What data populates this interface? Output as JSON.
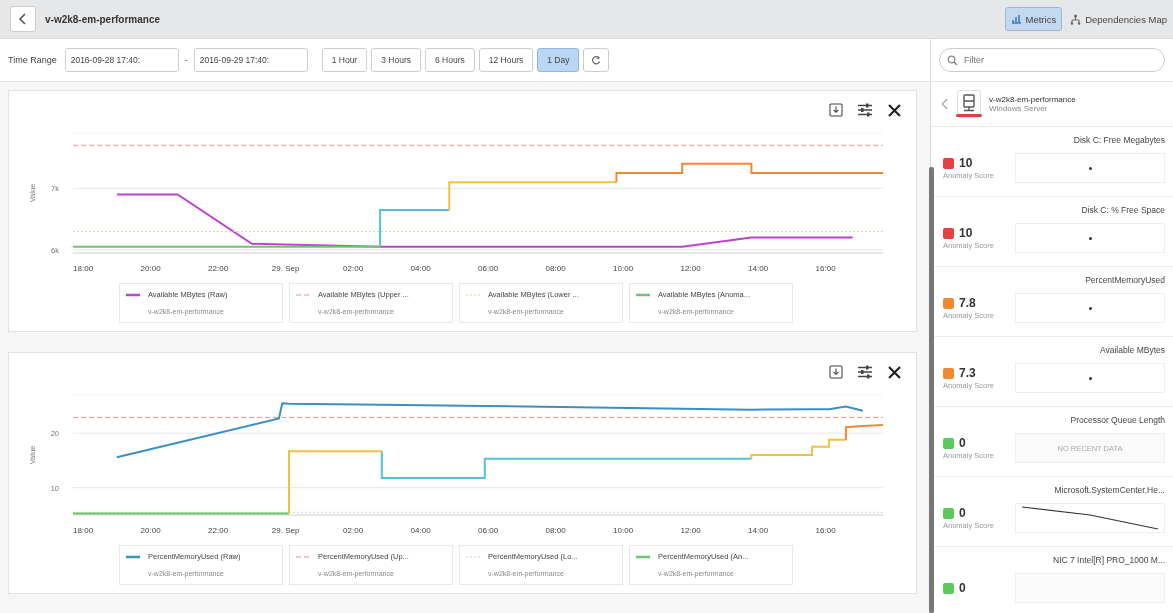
{
  "header": {
    "title": "v-w2k8-em-performance",
    "tabs": [
      {
        "label": "Metrics",
        "selected": true
      },
      {
        "label": "Dependencies Map",
        "selected": false
      }
    ]
  },
  "toolbar": {
    "label": "Time Range",
    "start": "2016-09-28 17:40:",
    "separator": "-",
    "end": "2016-09-29 17:40:",
    "ranges": [
      {
        "label": "1 Hour",
        "selected": false
      },
      {
        "label": "3 Hours",
        "selected": false
      },
      {
        "label": "6 Hours",
        "selected": false
      },
      {
        "label": "12 Hours",
        "selected": false
      },
      {
        "label": "1 Day",
        "selected": true
      }
    ]
  },
  "charts": [
    {
      "legend_sources": [
        "v-w2k8-em-performance",
        "v-w2k8-em-performance",
        "v-w2k8-em-performance",
        "v-w2k8-em-performance"
      ],
      "chart_data": {
        "type": "line",
        "ylabel": "Value",
        "xlim": [
          "2016-09-28 17:42",
          "2016-09-29 17:42"
        ],
        "ylim": [
          5950,
          7900
        ],
        "xticks": [
          {
            "value": "2016-09-28 18:00",
            "label": "18:00"
          },
          {
            "value": "2016-09-28 20:00",
            "label": "20:00"
          },
          {
            "value": "2016-09-28 22:00",
            "label": "22:00"
          },
          {
            "value": "2016-09-29 00:00",
            "label": "29. Sep"
          },
          {
            "value": "2016-09-29 02:00",
            "label": "02:00"
          },
          {
            "value": "2016-09-29 04:00",
            "label": "04:00"
          },
          {
            "value": "2016-09-29 06:00",
            "label": "06:00"
          },
          {
            "value": "2016-09-29 08:00",
            "label": "08:00"
          },
          {
            "value": "2016-09-29 10:00",
            "label": "10:00"
          },
          {
            "value": "2016-09-29 12:00",
            "label": "12:00"
          },
          {
            "value": "2016-09-29 14:00",
            "label": "14:00"
          },
          {
            "value": "2016-09-29 16:00",
            "label": "16:00"
          }
        ],
        "yticks": [
          {
            "value": 6000,
            "label": "6k"
          },
          {
            "value": 7000,
            "label": "7k"
          }
        ],
        "x": [
          "2016-09-28 17:42",
          "2016-09-28 19:00",
          "2016-09-28 20:48",
          "2016-09-28 23:00",
          "2016-09-29 02:48",
          "2016-09-29 02:48",
          "2016-09-29 04:00",
          "2016-09-29 04:51",
          "2016-09-29 04:51",
          "2016-09-29 09:48",
          "2016-09-29 09:48",
          "2016-09-29 11:45",
          "2016-09-29 11:45",
          "2016-09-29 13:48",
          "2016-09-29 13:48",
          "2016-09-29 15:48",
          "2016-09-29 16:48",
          "2016-09-29 17:42"
        ],
        "series": [
          {
            "name": "Available MBytes (Raw)",
            "color": "#c040d0",
            "values": [
              null,
              6900,
              6900,
              6100,
              6050,
              6050,
              6050,
              6050,
              6050,
              6050,
              6050,
              6050,
              6050,
              6200,
              6200,
              6200,
              6200,
              null
            ]
          },
          {
            "name": "Available MBytes (Upper ...",
            "color": "#e89090",
            "line_style": "dashed",
            "values": [
              7700,
              7700,
              7700,
              7700,
              7700,
              7700,
              7700,
              7700,
              7700,
              7700,
              7700,
              7700,
              7700,
              7700,
              7700,
              7700,
              7700,
              7700
            ]
          },
          {
            "name": "Available MBytes (Lower ...",
            "color": "#c8c890",
            "line_style": "dotted",
            "values": [
              6300,
              6300,
              6300,
              6300,
              6300,
              6300,
              6300,
              6300,
              6300,
              6300,
              6300,
              6300,
              6300,
              6300,
              6300,
              6300,
              6300,
              6300
            ]
          },
          {
            "name": "Available MBytes (Anoma...",
            "color": "#6cc76c",
            "values": [
              6050,
              6050,
              6050,
              6050,
              6050,
              null,
              null,
              null,
              null,
              null,
              null,
              null,
              null,
              null,
              null,
              null,
              null,
              null
            ]
          },
          {
            "color": "#4fc3d9",
            "values": [
              null,
              null,
              null,
              null,
              6050,
              6650,
              6650,
              6650,
              null,
              null,
              null,
              null,
              null,
              null,
              null,
              null,
              null,
              null
            ]
          },
          {
            "color": "#f0c040",
            "values": [
              null,
              null,
              null,
              null,
              null,
              null,
              null,
              6650,
              7100,
              7100,
              null,
              null,
              null,
              null,
              null,
              null,
              null,
              null
            ]
          },
          {
            "color": "#f08a30",
            "values": [
              null,
              null,
              null,
              null,
              null,
              null,
              null,
              null,
              null,
              7100,
              7250,
              7250,
              7400,
              7400,
              7250,
              7250,
              7250,
              7250
            ]
          }
        ]
      }
    },
    {
      "legend_sources": [
        "v-w2k8-em-performance",
        "v-w2k8-em-performance",
        "v-w2k8-em-performance",
        "v-w2k8-em-performance"
      ],
      "chart_data": {
        "type": "line",
        "ylabel": "Value",
        "xlim": [
          "2016-09-28 17:42",
          "2016-09-29 17:42"
        ],
        "ylim": [
          5,
          27
        ],
        "xticks": [
          {
            "value": "2016-09-28 18:00",
            "label": "18:00"
          },
          {
            "value": "2016-09-28 20:00",
            "label": "20:00"
          },
          {
            "value": "2016-09-28 22:00",
            "label": "22:00"
          },
          {
            "value": "2016-09-29 00:00",
            "label": "29. Sep"
          },
          {
            "value": "2016-09-29 02:00",
            "label": "02:00"
          },
          {
            "value": "2016-09-29 04:00",
            "label": "04:00"
          },
          {
            "value": "2016-09-29 06:00",
            "label": "06:00"
          },
          {
            "value": "2016-09-29 08:00",
            "label": "08:00"
          },
          {
            "value": "2016-09-29 10:00",
            "label": "10:00"
          },
          {
            "value": "2016-09-29 12:00",
            "label": "12:00"
          },
          {
            "value": "2016-09-29 14:00",
            "label": "14:00"
          },
          {
            "value": "2016-09-29 16:00",
            "label": "16:00"
          }
        ],
        "yticks": [
          10,
          20
        ],
        "x": [
          "2016-09-28 17:42",
          "2016-09-28 19:00",
          "2016-09-28 23:48",
          "2016-09-28 23:54",
          "2016-09-29 00:06",
          "2016-09-29 00:06",
          "2016-09-29 02:51",
          "2016-09-29 02:51",
          "2016-09-29 05:54",
          "2016-09-29 05:54",
          "2016-09-29 13:48",
          "2016-09-29 13:48",
          "2016-09-29 15:36",
          "2016-09-29 15:36",
          "2016-09-29 16:06",
          "2016-09-29 16:06",
          "2016-09-29 16:36",
          "2016-09-29 16:36",
          "2016-09-29 17:06",
          "2016-09-29 17:42"
        ],
        "series": [
          {
            "name": "PercentMemoryUsed (Raw)",
            "color": "#3a8fc0",
            "values": [
              null,
              15.6,
              22.7,
              25.5,
              25.4,
              25.4,
              25.2,
              25.2,
              25.0,
              25.0,
              24.3,
              24.3,
              24.4,
              24.4,
              24.4,
              24.4,
              24.9,
              24.9,
              24.1,
              null
            ]
          },
          {
            "name": "PercentMemoryUsed (Up...",
            "color": "#e89090",
            "line_style": "dashed",
            "values": [
              22.9,
              22.9,
              22.9,
              22.9,
              22.9,
              22.9,
              22.9,
              22.9,
              22.9,
              22.9,
              22.9,
              22.9,
              22.9,
              22.9,
              22.9,
              22.9,
              22.9,
              22.9,
              22.9,
              22.9
            ]
          },
          {
            "name": "PercentMemoryUsed (Lo...",
            "color": "#c0c0c0",
            "line_style": "dotted",
            "values": [
              5.5,
              5.5,
              5.5,
              5.5,
              5.5,
              5.5,
              5.5,
              5.5,
              5.5,
              5.5,
              5.5,
              5.5,
              5.5,
              5.5,
              5.5,
              5.5,
              5.5,
              5.5,
              5.5,
              5.5
            ]
          },
          {
            "name": "PercentMemoryUsed (An...",
            "color": "#6cc76c",
            "values": [
              5.3,
              5.3,
              5.3,
              5.3,
              5.3,
              null,
              null,
              null,
              null,
              null,
              null,
              null,
              null,
              null,
              null,
              null,
              null,
              null,
              null,
              null
            ]
          },
          {
            "color": "#4fc3d9",
            "values": [
              null,
              null,
              null,
              null,
              null,
              null,
              16.7,
              11.8,
              11.8,
              15.3,
              15.3,
              null,
              null,
              null,
              null,
              null,
              null,
              null,
              null,
              null
            ]
          },
          {
            "color": "#f0c040",
            "values": [
              null,
              null,
              null,
              null,
              5.3,
              16.7,
              16.7,
              null,
              null,
              null,
              15.3,
              16.0,
              16.0,
              17.5,
              17.5,
              18.8,
              18.8,
              null,
              null,
              null
            ]
          },
          {
            "color": "#f08a30",
            "values": [
              null,
              null,
              null,
              null,
              null,
              null,
              null,
              null,
              null,
              null,
              null,
              null,
              null,
              null,
              null,
              null,
              18.8,
              21.1,
              21.3,
              21.5
            ]
          }
        ]
      }
    }
  ],
  "side": {
    "filter": {
      "placeholder": "Filter"
    },
    "entity": {
      "name": "v-w2k8-em-performance",
      "type": "Windows Server"
    },
    "metrics": [
      {
        "kind": "dot",
        "name": "Disk C: Free Megabytes",
        "score": "10",
        "score_label": "Anomaly Score",
        "color": "#e84040"
      },
      {
        "kind": "dot",
        "name": "Disk C: % Free Space",
        "score": "10",
        "score_label": "Anomaly Score",
        "color": "#e84040"
      },
      {
        "kind": "dot",
        "name": "PercentMemoryUsed",
        "score": "7.8",
        "score_label": "Anomaly Score",
        "color": "#f08a30"
      },
      {
        "kind": "dot",
        "name": "Available MBytes",
        "score": "7.3",
        "score_label": "Anomaly Score",
        "color": "#f08a30"
      },
      {
        "kind": "no_data",
        "name": "Processor Queue Length",
        "score": "0",
        "score_label": "Anomaly Score",
        "color": "#5cc95c",
        "spark_text": "NO RECENT DATA"
      },
      {
        "kind": "line",
        "name": "Microsoft.SystemCenter.He...",
        "score": "0",
        "score_label": "Anomaly Score",
        "color": "#5cc95c"
      },
      {
        "kind": "no_data",
        "name": "NIC 7 Intel[R] PRO_1000 M...",
        "score": "0",
        "color": "#5cc95c"
      }
    ]
  }
}
